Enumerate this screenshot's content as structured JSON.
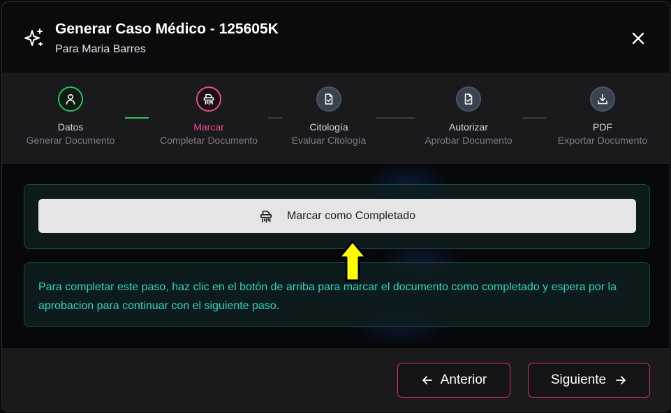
{
  "header": {
    "title": "Generar Caso Médico - 125605K",
    "subtitle": "Para Maria Barres",
    "icon": "sparkles-icon",
    "close_icon": "close-icon"
  },
  "steps": [
    {
      "label": "Datos",
      "sublabel": "Generar Documento",
      "status": "completed",
      "icon": "user-icon"
    },
    {
      "label": "Marcar",
      "sublabel": "Completar Documento",
      "status": "active",
      "icon": "shredder-icon"
    },
    {
      "label": "Citología",
      "sublabel": "Evaluar Citología",
      "status": "pending",
      "icon": "file-check-icon"
    },
    {
      "label": "Autorizar",
      "sublabel": "Aprobar Documento",
      "status": "pending",
      "icon": "file-check-icon"
    },
    {
      "label": "PDF",
      "sublabel": "Exportar Documento",
      "status": "pending",
      "icon": "download-icon"
    }
  ],
  "main": {
    "complete_button_label": "Marcar como Completado",
    "complete_button_icon": "shredder-icon",
    "info_text": "Para completar este paso, haz clic en el botón de arriba para marcar el documento como completado y espera por la aprobacion para continuar con el siguiente paso.",
    "annotation": "yellow-arrow-icon"
  },
  "footer": {
    "prev_label": "Anterior",
    "next_label": "Siguiente"
  },
  "colors": {
    "completed": "#22c55e",
    "active": "#ec4899",
    "pending": "#4b5563",
    "info_text": "#2dd4bf",
    "button_border": "#db2777",
    "arrow": "#ffff00"
  }
}
